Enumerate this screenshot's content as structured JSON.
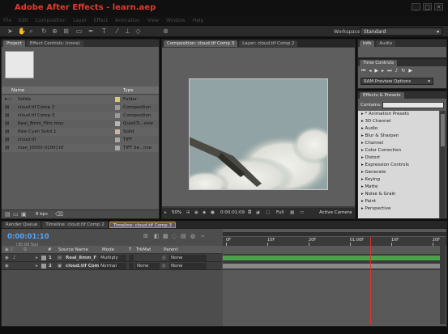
{
  "window": {
    "title": "Adobe After Effects - learn.aep",
    "min_glyph": "_",
    "max_glyph": "□",
    "close_glyph": "✕"
  },
  "menu": [
    "File",
    "Edit",
    "Composition",
    "Layer",
    "Effect",
    "Animation",
    "View",
    "Window",
    "Help"
  ],
  "toolbar": {
    "workspace_label": "Workspace:",
    "workspace_value": "Standard"
  },
  "project_panel": {
    "tabs": [
      "Project",
      "Effect Controls: (none)"
    ],
    "columns": {
      "name": "Name",
      "type": "Type"
    },
    "items": [
      {
        "name": "Solids",
        "type": "Folder",
        "color": "#d8c77a"
      },
      {
        "name": "cloud.tif Comp 2",
        "type": "Composition",
        "color": "#9a9a9a"
      },
      {
        "name": "cloud.tif Comp 3",
        "type": "Composition",
        "color": "#9a9a9a"
      },
      {
        "name": "Real_8mm_Film.mov",
        "type": "QuickTi...ovie",
        "color": "#b7b7b7"
      },
      {
        "name": "Pale Cyan Solid 1",
        "type": "Solid",
        "color": "#c9b8a0"
      },
      {
        "name": "cloud.tif",
        "type": "TIFF",
        "color": "#a8a8a8"
      },
      {
        "name": "rose_[0000-0100].tif",
        "type": "TIFF Se...nce",
        "color": "#a8a8a8"
      }
    ],
    "footer_bpc": "8 bpc"
  },
  "comp_panel": {
    "tabs": [
      "Composition: cloud.tif Comp 3",
      "Layer: cloud.tif Comp 2"
    ],
    "zoom": "50%",
    "timecode": "0:00:01:09",
    "resolution": "Full",
    "camera": "Active Camera"
  },
  "right_panels": {
    "info_tabs": [
      "Info",
      "Audio"
    ],
    "time_controls_tab": "Time Controls",
    "ram_preview": "RAM Preview Options",
    "effects_tab": "Effects & Presets",
    "contains_label": "Contains:",
    "effects": [
      "* Animation Presets",
      "3D Channel",
      "Audio",
      "Blur & Sharpen",
      "Channel",
      "Color Correction",
      "Distort",
      "Expression Controls",
      "Generate",
      "Keying",
      "Matte",
      "Noise & Grain",
      "Paint",
      "Perspective"
    ]
  },
  "timeline": {
    "tabs": [
      "Render Queue",
      "Timeline: cloud.tif Comp 2",
      "Timeline: cloud.tif Comp 3"
    ],
    "current_time": "0:00:01:10",
    "fps": "(30.00 fps)",
    "columns": {
      "num": "#",
      "source": "Source Name",
      "mode": "Mode",
      "t": "T",
      "trkmat": "TrkMat",
      "parent": "Parent"
    },
    "ruler": [
      "0F",
      "10F",
      "20F",
      "01:00F",
      "10F",
      "20F"
    ],
    "layers": [
      {
        "num": "1",
        "name": "Real_8mm_F",
        "mode": "Multiply",
        "trkmat": "",
        "parent": "None",
        "bar_color": "#4aa24a"
      },
      {
        "num": "2",
        "name": "cloud.tif Com",
        "mode": "Normal",
        "trkmat": "None",
        "parent": "None",
        "bar_color": "#8a8a8a"
      }
    ],
    "playhead_position_fraction": 0.68
  }
}
